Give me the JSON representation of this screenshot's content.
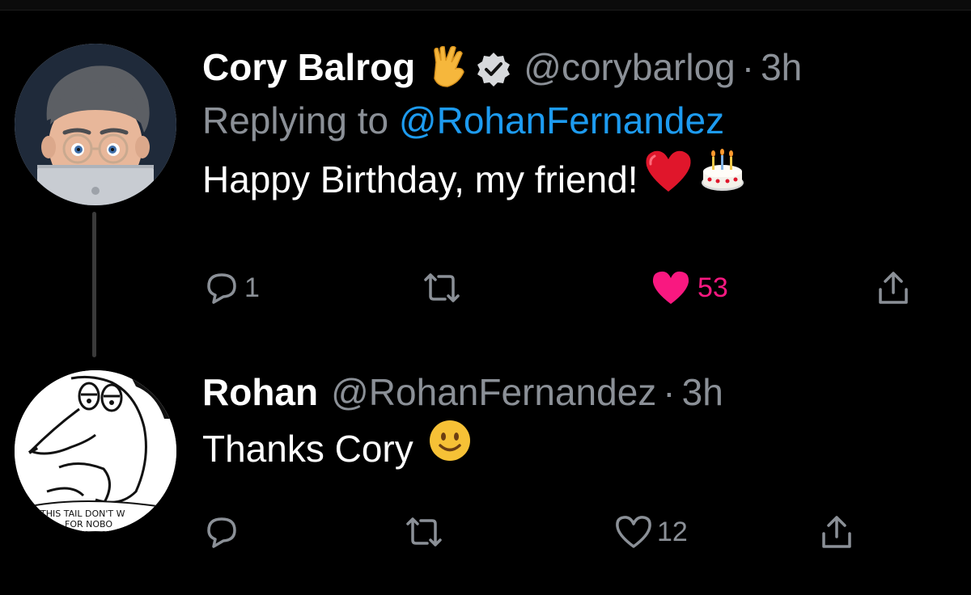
{
  "tweets": [
    {
      "display_name": "Cory Balrog",
      "handle": "@corybarlog",
      "separator": "·",
      "time": "3h",
      "reply_prefix": "Replying to",
      "reply_to": "@RohanFernandez",
      "text": "Happy Birthday, my friend!",
      "emoji": [
        "red-heart",
        "birthday-cake"
      ],
      "badges": [
        "vulcan-salute",
        "verified"
      ],
      "actions": {
        "reply_count": "1",
        "retweet_count": "",
        "like_count": "53",
        "liked": true
      }
    },
    {
      "display_name": "Rohan",
      "handle": "@RohanFernandez",
      "separator": "·",
      "time": "3h",
      "text": "Thanks Cory",
      "emoji": [
        "slightly-smiling-face"
      ],
      "avatar_caption": [
        "THIS TAIL DON'T W",
        "FOR NOBO"
      ],
      "actions": {
        "reply_count": "",
        "retweet_count": "",
        "like_count": "12",
        "liked": false
      }
    }
  ],
  "colors": {
    "background": "#000000",
    "muted": "#8b9097",
    "link": "#1d9bf0",
    "like_active": "#f91880"
  }
}
